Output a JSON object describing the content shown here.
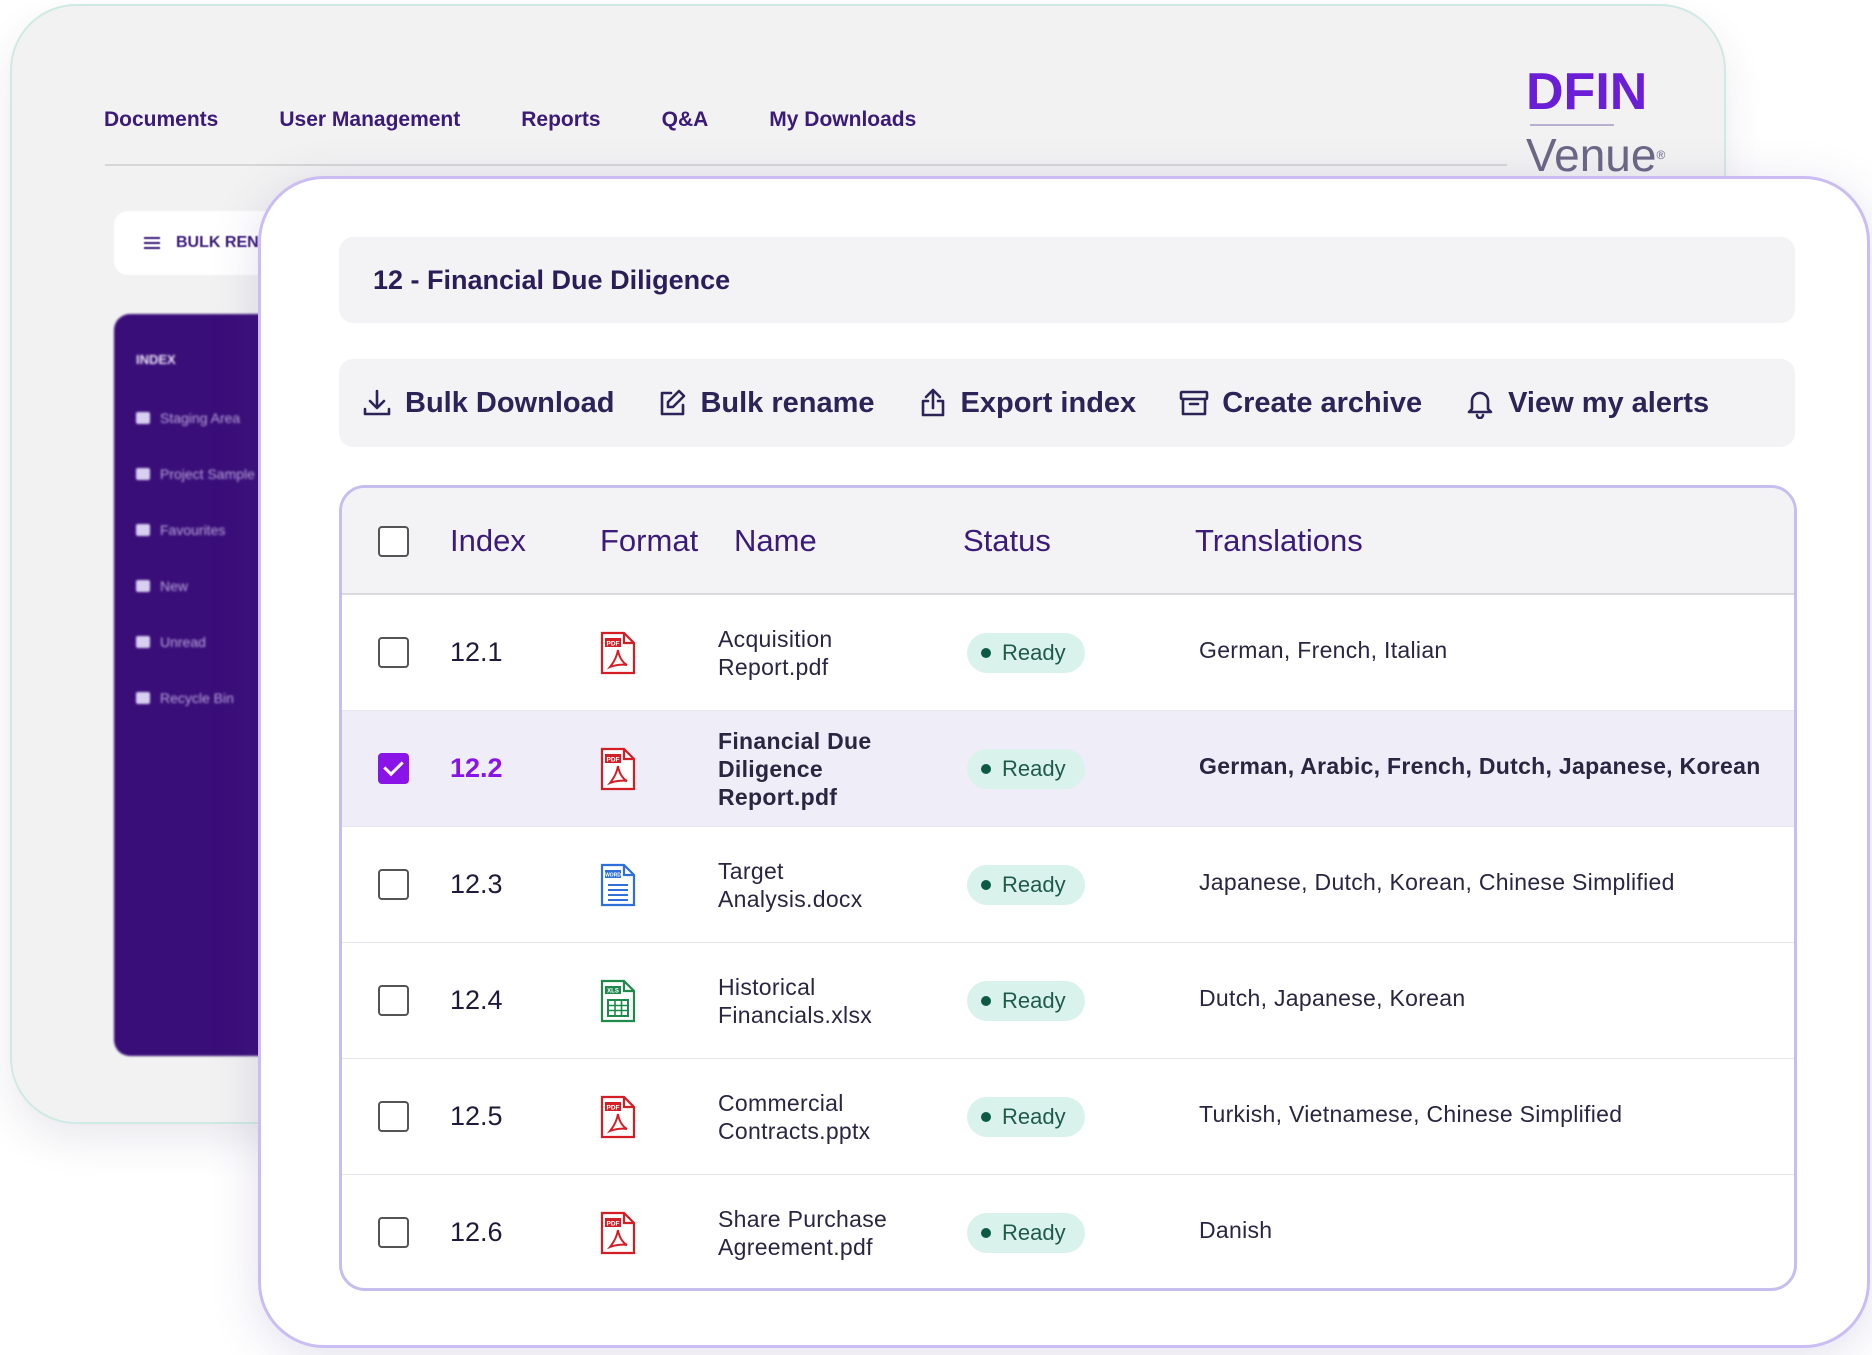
{
  "brand": {
    "logo_main": "DFIN",
    "logo_sub": "Venue",
    "logo_mark": "®",
    "accent_color": "#8a14e8",
    "nav_color": "#3b1a78"
  },
  "nav": {
    "items": [
      {
        "label": "Documents"
      },
      {
        "label": "User Management"
      },
      {
        "label": "Reports"
      },
      {
        "label": "Q&A"
      },
      {
        "label": "My Downloads"
      }
    ]
  },
  "back_panel": {
    "bulk_button_label": "BULK RENA",
    "sidebar_title": "INDEX",
    "sidebar_items": [
      {
        "label": "Staging Area",
        "icon": "document-icon"
      },
      {
        "label": "Project Sample",
        "icon": "folder-icon"
      },
      {
        "label": "Favourites",
        "icon": "star-icon"
      },
      {
        "label": "New",
        "icon": "sparkle-icon"
      },
      {
        "label": "Unread",
        "icon": "mail-icon"
      },
      {
        "label": "Recycle Bin",
        "icon": "recycle-icon"
      }
    ]
  },
  "folder": {
    "title": "12 - Financial Due Diligence"
  },
  "toolbar": {
    "bulk_download": "Bulk Download",
    "bulk_rename": "Bulk rename",
    "export_index": "Export index",
    "create_archive": "Create archive",
    "view_alerts": "View my alerts"
  },
  "table": {
    "columns": {
      "index": "Index",
      "format": "Format",
      "name": "Name",
      "status": "Status",
      "translations": "Translations"
    },
    "rows": [
      {
        "index": "12.1",
        "format": "pdf",
        "name_line1": "Acquisition",
        "name_line2": "Report.pdf",
        "name_line3": "",
        "status": "Ready",
        "translations": "German, French, Italian",
        "selected": false
      },
      {
        "index": "12.2",
        "format": "pdf",
        "name_line1": "Financial Due",
        "name_line2": "Diligence",
        "name_line3": "Report.pdf",
        "status": "Ready",
        "translations": "German, Arabic, French, Dutch, Japanese, Korean",
        "selected": true
      },
      {
        "index": "12.3",
        "format": "word",
        "name_line1": "Target",
        "name_line2": "Analysis.docx",
        "name_line3": "",
        "status": "Ready",
        "translations": "Japanese, Dutch, Korean, Chinese Simplified",
        "selected": false
      },
      {
        "index": "12.4",
        "format": "xls",
        "name_line1": "Historical",
        "name_line2": "Financials.xlsx",
        "name_line3": "",
        "status": "Ready",
        "translations": "Dutch, Japanese, Korean",
        "selected": false
      },
      {
        "index": "12.5",
        "format": "pdf",
        "name_line1": "Commercial",
        "name_line2": "Contracts.pptx",
        "name_line3": "",
        "status": "Ready",
        "translations": "Turkish, Vietnamese, Chinese Simplified",
        "selected": false
      },
      {
        "index": "12.6",
        "format": "pdf",
        "name_line1": "Share Purchase",
        "name_line2": "Agreement.pdf",
        "name_line3": "",
        "status": "Ready",
        "translations": "Danish",
        "selected": false
      }
    ],
    "format_labels": {
      "pdf": "PDF",
      "word": "WORD",
      "xls": "XLS"
    },
    "status_color": "#d9f2ec"
  }
}
